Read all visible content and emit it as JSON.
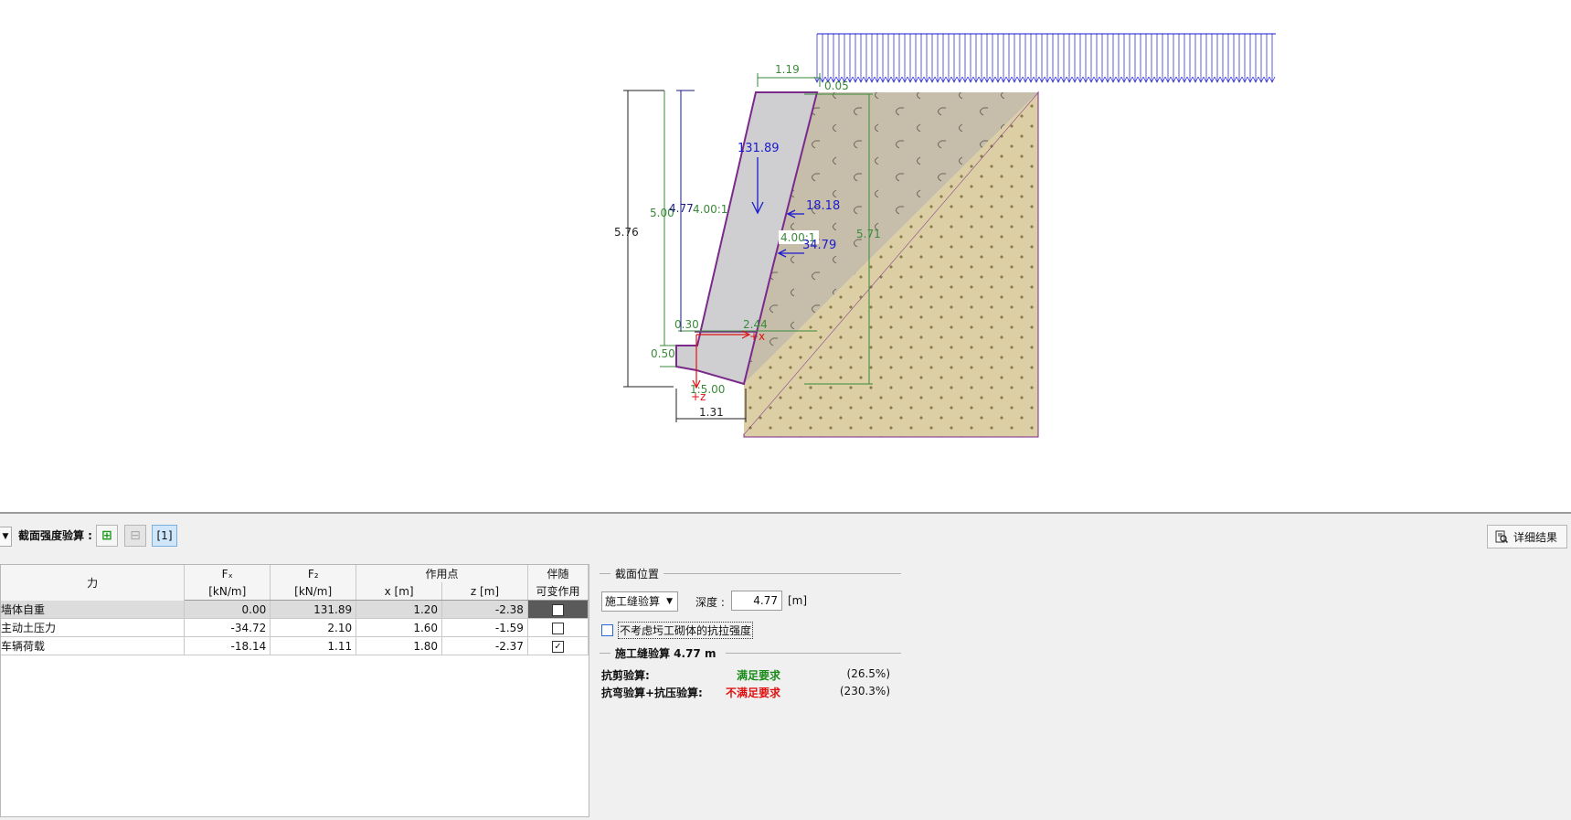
{
  "drawing": {
    "dims_black": {
      "total_height": "5.76",
      "base_width": "1.31"
    },
    "dims_green": {
      "top_width": "1.19",
      "top_small": "0.05",
      "wall_height": "5.00",
      "slope_left": "4.00:1",
      "slope_right": "4.00:1",
      "backfill_height": "5.71",
      "toe": "0.30",
      "heel": "2.44",
      "base_height": "0.50",
      "base_slope": "1:5.00"
    },
    "dims_navy": {
      "section_depth": "4.77"
    },
    "forces": {
      "weight": "131.89",
      "pressure_1": "18.18",
      "pressure_2": "34.79"
    },
    "axes": {
      "x": "+x",
      "z": "+z"
    }
  },
  "toolbar": {
    "title": "截面强度验算 :",
    "add_icon": "plus-icon",
    "remove_icon": "minus-icon",
    "tab_label": "[1]",
    "detail_button": "详细结果",
    "detail_icon": "report-icon"
  },
  "table": {
    "headers": {
      "force": "力",
      "fx": "Fₓ",
      "fx_unit": "[kN/m]",
      "fz": "F₂",
      "fz_unit": "[kN/m]",
      "point": "作用点",
      "x": "x [m]",
      "z": "z [m]",
      "accompany": "伴随",
      "variable": "可变作用"
    },
    "rows": [
      {
        "name": "墙体自重",
        "fx": "0.00",
        "fz": "131.89",
        "x": "1.20",
        "z": "-2.38",
        "checked": false,
        "selected": true
      },
      {
        "name": "主动土压力",
        "fx": "-34.72",
        "fz": "2.10",
        "x": "1.60",
        "z": "-1.59",
        "checked": false,
        "selected": false
      },
      {
        "name": "车辆荷载",
        "fx": "-18.14",
        "fz": "1.11",
        "x": "1.80",
        "z": "-2.37",
        "checked": true,
        "selected": false
      }
    ]
  },
  "section": {
    "group_title": "截面位置",
    "mode_value": "施工缝验算",
    "depth_label": "深度 :",
    "depth_value": "4.77",
    "depth_unit": "[m]",
    "ignore_tension_label": "不考虑圬工砌体的抗拉强度",
    "result_title": "施工缝验算 4.77 m",
    "shear_label": "抗剪验算:",
    "shear_status": "满足要求",
    "shear_pct": "(26.5%)",
    "bending_label": "抗弯验算+抗压验算:",
    "bending_status": "不满足要求",
    "bending_pct": "(230.3%)"
  },
  "colors": {
    "ok": "#1a8a1a",
    "fail": "#e01010",
    "dim_green": "#3a8a3a",
    "force_blue": "#1a1ad0",
    "wall_outline": "#7a2a8a"
  }
}
